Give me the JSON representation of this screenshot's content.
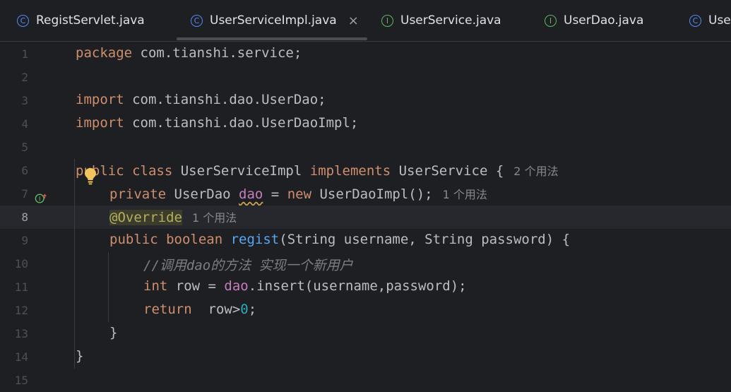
{
  "tabs": [
    {
      "label": "RegistServlet.java",
      "icon": "class-icon",
      "active": false
    },
    {
      "label": "UserServiceImpl.java",
      "icon": "class-icon",
      "active": true
    },
    {
      "label": "UserService.java",
      "icon": "interface-icon",
      "active": false
    },
    {
      "label": "UserDao.java",
      "icon": "interface-icon",
      "active": false
    },
    {
      "label": "Use",
      "icon": "class-icon",
      "active": false
    }
  ],
  "tab_close": "×",
  "lines": [
    {
      "num": "1"
    },
    {
      "num": "2"
    },
    {
      "num": "3"
    },
    {
      "num": "4"
    },
    {
      "num": "5"
    },
    {
      "num": "6"
    },
    {
      "num": "7"
    },
    {
      "num": "8"
    },
    {
      "num": "9"
    },
    {
      "num": "10"
    },
    {
      "num": "11"
    },
    {
      "num": "12"
    },
    {
      "num": "13"
    },
    {
      "num": "14"
    },
    {
      "num": "15"
    }
  ],
  "code": {
    "l1": {
      "kw": "package",
      "rest": " com.tianshi.service;"
    },
    "l3": {
      "kw": "import",
      "rest": " com.tianshi.dao.UserDao;"
    },
    "l4": {
      "kw": "import",
      "rest": " com.tianshi.dao.UserDaoImpl;"
    },
    "l6": {
      "kw1": "public class",
      "name": " UserServiceImpl ",
      "kw2": "implements",
      "rest": " UserService {",
      "hint": "2 个用法"
    },
    "l7": {
      "kw": "private",
      "type": " UserDao ",
      "field": "dao",
      "eq": " = ",
      "kw2": "new",
      "rest": " UserDaoImpl();",
      "hint": "1 个用法"
    },
    "l8": {
      "ann": "@Override",
      "hint": "1 个用法"
    },
    "l9": {
      "kw": "public boolean",
      "sp": " ",
      "fn": "regist",
      "rest": "(String username, String password) {"
    },
    "l10": {
      "comment": "//调用dao的方法 实现一个新用户"
    },
    "l11": {
      "kw": "int",
      "mid": " row = ",
      "field": "dao",
      "rest": ".insert(username,password);"
    },
    "l12": {
      "kw": "return",
      "mid": "  row>",
      "num": "0",
      "rest": ";"
    },
    "l13": {
      "text": "}"
    },
    "l14": {
      "text": "}"
    }
  },
  "colors": {
    "keyword": "#cf8e6d",
    "field": "#c77dbb",
    "method": "#56a8f5",
    "number": "#2aacb8",
    "annotation": "#b3ae60",
    "comment": "#7a7e85"
  }
}
